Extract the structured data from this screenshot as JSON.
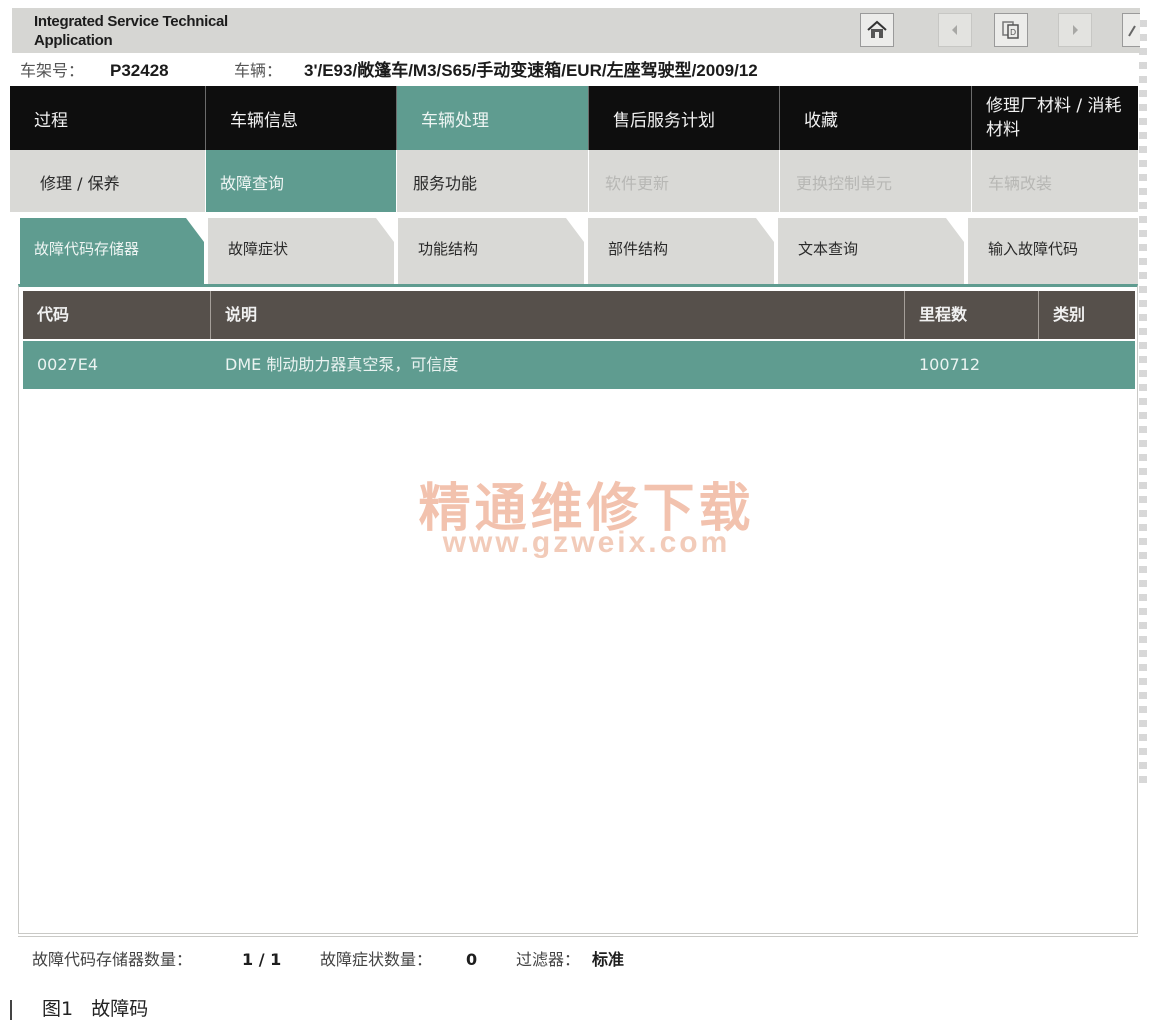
{
  "app": {
    "title_line1": "Integrated Service Technical",
    "title_line2": "Application"
  },
  "toolbar": {
    "home_icon": "home-icon",
    "back_icon": "arrow-left-icon",
    "copy_icon": "copy-document-icon",
    "forward_icon": "arrow-right-icon"
  },
  "vehicle": {
    "vin_label": "车架号：",
    "vin_value": "P32428",
    "vehicle_label": "车辆：",
    "vehicle_value": "3'/E93/敞篷车/M3/S65/手动变速箱/EUR/左座驾驶型/2009/12"
  },
  "nav_main": [
    {
      "label": "过程"
    },
    {
      "label": "车辆信息"
    },
    {
      "label": "车辆处理"
    },
    {
      "label": "售后服务计划"
    },
    {
      "label": "收藏"
    },
    {
      "label": "修理厂材料 / 消耗材料"
    }
  ],
  "nav_sub": [
    {
      "label": "修理 / 保养"
    },
    {
      "label": "故障查询"
    },
    {
      "label": "服务功能"
    },
    {
      "label": "软件更新"
    },
    {
      "label": "更换控制单元"
    },
    {
      "label": "车辆改装"
    }
  ],
  "nav_diag": [
    {
      "label": "故障代码存储器"
    },
    {
      "label": "故障症状"
    },
    {
      "label": "功能结构"
    },
    {
      "label": "部件结构"
    },
    {
      "label": "文本查询"
    },
    {
      "label": "输入故障代码"
    }
  ],
  "table": {
    "headers": {
      "code": "代码",
      "desc": "说明",
      "mileage": "里程数",
      "type": "类别"
    },
    "rows": [
      {
        "code": "0027E4",
        "desc": "DME 制动助力器真空泵，可信度",
        "mileage": "100712",
        "type": ""
      }
    ]
  },
  "watermark": {
    "line1": "精通维修下载",
    "line2": "www.gzweix.com"
  },
  "status": {
    "fault_mem_label": "故障代码存储器数量：",
    "fault_mem_value": "1 / 1",
    "symptom_label": "故障症状数量：",
    "symptom_value": "0",
    "filter_label": "过滤器：",
    "filter_value": "标准"
  },
  "caption": {
    "figure": "图1",
    "text": "故障码"
  },
  "colors": {
    "accent": "#5f9c90",
    "nav_dark": "#0e0e0e",
    "table_header": "#56504b"
  }
}
